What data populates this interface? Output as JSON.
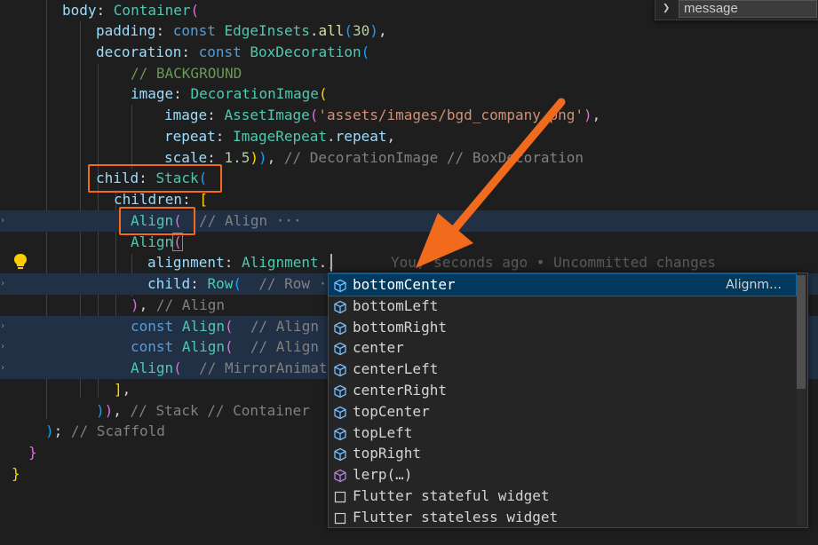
{
  "code": {
    "l1_prop": "body",
    "l1_type": "Container",
    "l2_prop": "padding",
    "l2_kw": "const",
    "l2_type": "EdgeInsets",
    "l2_fn": "all",
    "l2_num": "30",
    "l3_prop": "decoration",
    "l3_kw": "const",
    "l3_type": "BoxDecoration",
    "l4_comment": "// BACKGROUND",
    "l5_prop": "image",
    "l5_type": "DecorationImage",
    "l6_prop": "image",
    "l6_type": "AssetImage",
    "l6_str": "'assets/images/bgd_company.png'",
    "l7_prop": "repeat",
    "l7_type": "ImageRepeat",
    "l7_val": "repeat",
    "l8_prop": "scale",
    "l8_num": "1.5",
    "l8_label": "// DecorationImage // BoxDecoration",
    "l9_prop": "child",
    "l9_type": "Stack",
    "l10_prop": "children",
    "l11_type": "Align",
    "l11_label": "// Align ···",
    "l12_type": "Align",
    "l13_prop": "alignment",
    "l13_type": "Alignment",
    "l13_ghost": "You, seconds ago • Uncommitted changes",
    "l14_prop": "child",
    "l14_type": "Row",
    "l14_label": "// Row ···",
    "l15_label": "// Align",
    "l16_kw": "const",
    "l16_type": "Align",
    "l16_label": "// Align ···",
    "l17_kw": "const",
    "l17_type": "Align",
    "l17_label": "// Align ···",
    "l18_type": "Align",
    "l18_label": "// MirrorAnimati",
    "l20_label": "// Stack // Container",
    "l21_label": "// Scaffold"
  },
  "find_widget": {
    "value": "message"
  },
  "suggestions": {
    "items": [
      {
        "label": "bottomCenter",
        "detail": "Alignm…",
        "icon": "cube-icon",
        "selected": true
      },
      {
        "label": "bottomLeft",
        "icon": "cube-icon"
      },
      {
        "label": "bottomRight",
        "icon": "cube-icon"
      },
      {
        "label": "center",
        "icon": "cube-icon"
      },
      {
        "label": "centerLeft",
        "icon": "cube-icon"
      },
      {
        "label": "centerRight",
        "icon": "cube-icon"
      },
      {
        "label": "topCenter",
        "icon": "cube-icon"
      },
      {
        "label": "topLeft",
        "icon": "cube-icon"
      },
      {
        "label": "topRight",
        "icon": "cube-icon"
      },
      {
        "label": "lerp(…)",
        "icon": "method-cube-icon"
      },
      {
        "label": "Flutter stateful widget",
        "icon": "snippet-icon"
      },
      {
        "label": "Flutter stateless widget",
        "icon": "snippet-icon"
      }
    ]
  },
  "colors": {
    "annotation": "#f26b1d",
    "selection": "#04395e",
    "field_icon": "#75beff",
    "method_icon": "#b180d7"
  }
}
